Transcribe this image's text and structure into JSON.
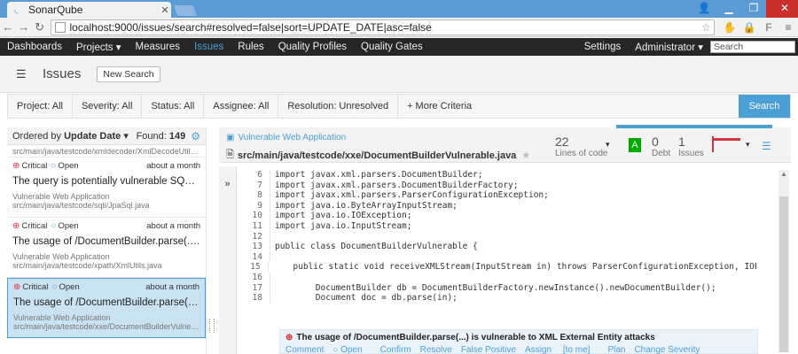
{
  "browser": {
    "tab_title": "SonarQube",
    "url": "localhost:9000/issues/search#resolved=false|sort=UPDATE_DATE|asc=false"
  },
  "nav": {
    "items": [
      "Dashboards",
      "Projects",
      "Measures",
      "Issues",
      "Rules",
      "Quality Profiles",
      "Quality Gates"
    ],
    "settings": "Settings",
    "admin": "Administrator",
    "search_placeholder": "Search"
  },
  "header": {
    "title": "Issues",
    "new_search": "New Search"
  },
  "filters": {
    "project": "Project: All",
    "severity": "Severity: All",
    "status": "Status: All",
    "assignee": "Assignee: All",
    "resolution": "Resolution: Unresolved",
    "more": "+ More Criteria",
    "search": "Search"
  },
  "list": {
    "ordered_by_prefix": "Ordered by",
    "ordered_by_value": "Update Date",
    "found_label": "Found:",
    "found_count": "149",
    "top_path": "src/main/java/testcode/xmldecoder/XmlDecodeUtil.j...",
    "issues": [
      {
        "severity": "Critical",
        "status": "Open",
        "time": "about a month",
        "message": "The query is potentially vulnerable SQL/JPQL ...",
        "component": "Vulnerable Web Application",
        "path": "src/main/java/testcode/sqli/JpaSql.java"
      },
      {
        "severity": "Critical",
        "status": "Open",
        "time": "about a month",
        "message": "The usage of /DocumentBuilder.parse(...) is v...",
        "component": "Vulnerable Web Application",
        "path": "src/main/java/testcode/xpath/XmlUtils.java"
      },
      {
        "severity": "Critical",
        "status": "Open",
        "time": "about a month",
        "message": "The usage of /DocumentBuilder.parse(...) is v...",
        "component": "Vulnerable Web Application",
        "path": "src/main/java/testcode/xxe/DocumentBuilderVulnera..."
      }
    ]
  },
  "file": {
    "project": "Vulnerable Web Application",
    "path": "src/main/java/testcode/xxe/DocumentBuilderVulnerable.java",
    "lines_value": "22",
    "lines_label": "Lines of code",
    "rating": "A",
    "debt_value": "0",
    "debt_label": "Debt",
    "issues_value": "1",
    "issues_label": "Issues"
  },
  "code": {
    "lines": [
      {
        "n": "6",
        "t": "import javax.xml.parsers.DocumentBuilder;"
      },
      {
        "n": "7",
        "t": "import javax.xml.parsers.DocumentBuilderFactory;"
      },
      {
        "n": "8",
        "t": "import javax.xml.parsers.ParserConfigurationException;"
      },
      {
        "n": "9",
        "t": "import java.io.ByteArrayInputStream;"
      },
      {
        "n": "10",
        "t": "import java.io.IOException;"
      },
      {
        "n": "11",
        "t": "import java.io.InputStream;"
      },
      {
        "n": "12",
        "t": ""
      },
      {
        "n": "13",
        "t": "public class DocumentBuilderVulnerable {"
      },
      {
        "n": "14",
        "t": ""
      },
      {
        "n": "15",
        "t": "    public static void receiveXMLStream(InputStream in) throws ParserConfigurationException, IOException, SA"
      },
      {
        "n": "16",
        "t": ""
      },
      {
        "n": "17",
        "t": "        DocumentBuilder db = DocumentBuilderFactory.newInstance().newDocumentBuilder();"
      },
      {
        "n": "18",
        "t": "        Document doc = db.parse(in);"
      }
    ]
  },
  "issue_box": {
    "title": "The usage of /DocumentBuilder.parse(...) is vulnerable to XML External Entity attacks",
    "actions": [
      "Comment",
      "Open",
      "Confirm",
      "Resolve",
      "False Positive",
      "Assign",
      "[to me]",
      "Plan",
      "Change Severity"
    ]
  }
}
